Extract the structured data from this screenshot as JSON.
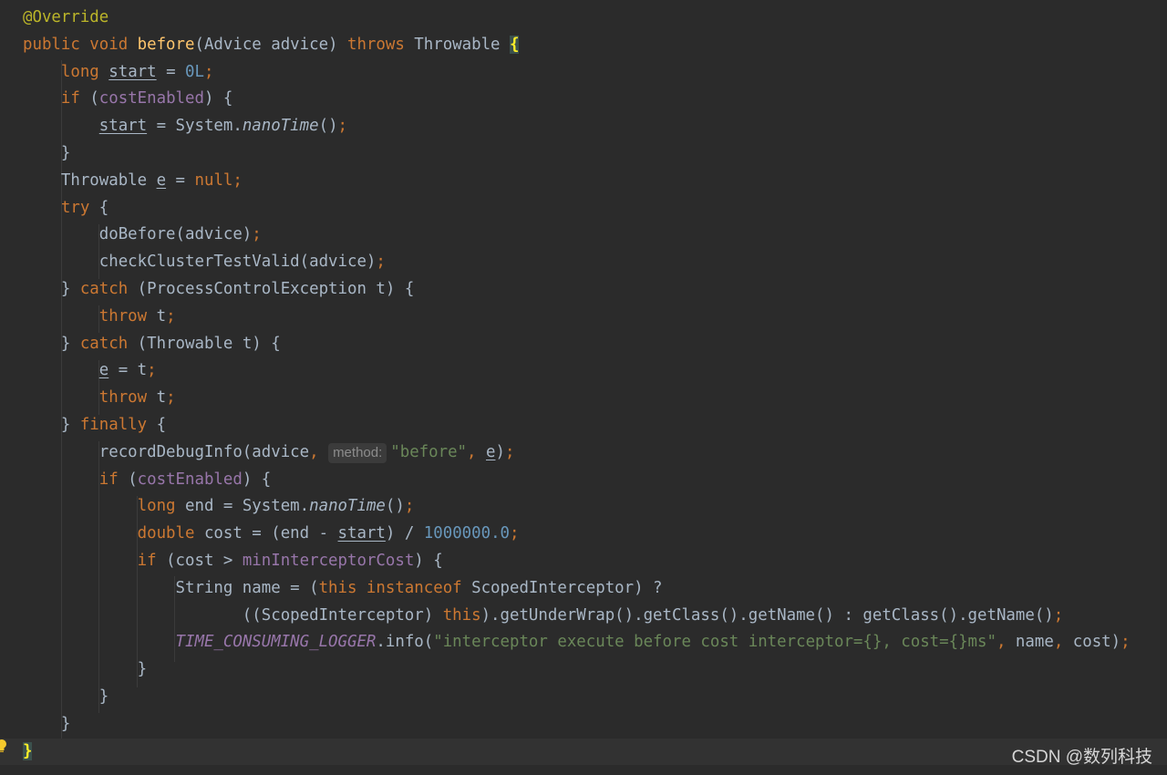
{
  "editor": {
    "lines": [
      {
        "segments": [
          {
            "t": "@Override",
            "c": "ann"
          }
        ]
      },
      {
        "segments": [
          {
            "t": "public void ",
            "c": "kw"
          },
          {
            "t": "before",
            "c": "fn"
          },
          {
            "t": "(Advice advice) "
          },
          {
            "t": "throws ",
            "c": "kw"
          },
          {
            "t": "Throwable "
          },
          {
            "t": "{",
            "c": "brace-hl"
          }
        ]
      },
      {
        "segments": [
          {
            "t": "    "
          },
          {
            "t": "long ",
            "c": "kw"
          },
          {
            "t": "start",
            "c": "ul"
          },
          {
            "t": " = "
          },
          {
            "t": "0L",
            "c": "num"
          },
          {
            "t": ";",
            "c": "kw"
          }
        ]
      },
      {
        "segments": [
          {
            "t": "    "
          },
          {
            "t": "if ",
            "c": "kw"
          },
          {
            "t": "("
          },
          {
            "t": "costEnabled",
            "c": "field"
          },
          {
            "t": ") {"
          }
        ]
      },
      {
        "segments": [
          {
            "t": "        "
          },
          {
            "t": "start",
            "c": "ul"
          },
          {
            "t": " = System."
          },
          {
            "t": "nanoTime",
            "c": "italic"
          },
          {
            "t": "()"
          },
          {
            "t": ";",
            "c": "kw"
          }
        ]
      },
      {
        "segments": [
          {
            "t": "    }"
          }
        ]
      },
      {
        "segments": [
          {
            "t": "    Throwable "
          },
          {
            "t": "e",
            "c": "ul"
          },
          {
            "t": " = "
          },
          {
            "t": "null",
            "c": "kw"
          },
          {
            "t": ";",
            "c": "kw"
          }
        ]
      },
      {
        "segments": [
          {
            "t": "    "
          },
          {
            "t": "try ",
            "c": "kw"
          },
          {
            "t": "{"
          }
        ]
      },
      {
        "segments": [
          {
            "t": "        doBefore(advice)"
          },
          {
            "t": ";",
            "c": "kw"
          }
        ]
      },
      {
        "segments": [
          {
            "t": "        checkClusterTestValid(advice)"
          },
          {
            "t": ";",
            "c": "kw"
          }
        ]
      },
      {
        "segments": [
          {
            "t": "    } "
          },
          {
            "t": "catch ",
            "c": "kw"
          },
          {
            "t": "(ProcessControlException t) {"
          }
        ]
      },
      {
        "segments": [
          {
            "t": "        "
          },
          {
            "t": "throw ",
            "c": "kw"
          },
          {
            "t": "t"
          },
          {
            "t": ";",
            "c": "kw"
          }
        ]
      },
      {
        "segments": [
          {
            "t": "    } "
          },
          {
            "t": "catch ",
            "c": "kw"
          },
          {
            "t": "(Throwable t) {"
          }
        ]
      },
      {
        "segments": [
          {
            "t": "        "
          },
          {
            "t": "e",
            "c": "ul"
          },
          {
            "t": " = t"
          },
          {
            "t": ";",
            "c": "kw"
          }
        ]
      },
      {
        "segments": [
          {
            "t": "        "
          },
          {
            "t": "throw ",
            "c": "kw"
          },
          {
            "t": "t"
          },
          {
            "t": ";",
            "c": "kw"
          }
        ]
      },
      {
        "segments": [
          {
            "t": "    } "
          },
          {
            "t": "finally ",
            "c": "kw"
          },
          {
            "t": "{"
          }
        ]
      },
      {
        "segments": [
          {
            "t": "        recordDebugInfo(advice"
          },
          {
            "t": ", ",
            "c": "kw"
          },
          {
            "t": "method:",
            "c": "hint"
          },
          {
            "t": "\"before\"",
            "c": "str"
          },
          {
            "t": ", ",
            "c": "kw"
          },
          {
            "t": "e",
            "c": "ul"
          },
          {
            "t": ")"
          },
          {
            "t": ";",
            "c": "kw"
          }
        ]
      },
      {
        "segments": [
          {
            "t": "        "
          },
          {
            "t": "if ",
            "c": "kw"
          },
          {
            "t": "("
          },
          {
            "t": "costEnabled",
            "c": "field"
          },
          {
            "t": ") {"
          }
        ]
      },
      {
        "segments": [
          {
            "t": "            "
          },
          {
            "t": "long ",
            "c": "kw"
          },
          {
            "t": "end = System."
          },
          {
            "t": "nanoTime",
            "c": "italic"
          },
          {
            "t": "()"
          },
          {
            "t": ";",
            "c": "kw"
          }
        ]
      },
      {
        "segments": [
          {
            "t": "            "
          },
          {
            "t": "double ",
            "c": "kw"
          },
          {
            "t": "cost = (end - "
          },
          {
            "t": "start",
            "c": "ul"
          },
          {
            "t": ") / "
          },
          {
            "t": "1000000.0",
            "c": "num"
          },
          {
            "t": ";",
            "c": "kw"
          }
        ]
      },
      {
        "segments": [
          {
            "t": "            "
          },
          {
            "t": "if ",
            "c": "kw"
          },
          {
            "t": "(cost > "
          },
          {
            "t": "minInterceptorCost",
            "c": "field"
          },
          {
            "t": ") {"
          }
        ]
      },
      {
        "segments": [
          {
            "t": "                String name = ("
          },
          {
            "t": "this instanceof ",
            "c": "kw"
          },
          {
            "t": "ScopedInterceptor) ?"
          }
        ]
      },
      {
        "segments": [
          {
            "t": "                       ((ScopedInterceptor) "
          },
          {
            "t": "this",
            "c": "kw"
          },
          {
            "t": ").getUnderWrap().getClass().getName() : getClass().getName()"
          },
          {
            "t": ";",
            "c": "kw"
          }
        ]
      },
      {
        "segments": [
          {
            "t": "                "
          },
          {
            "t": "TIME_CONSUMING_LOGGER",
            "c": "static"
          },
          {
            "t": ".info("
          },
          {
            "t": "\"interceptor execute before cost interceptor={}, cost={}ms\"",
            "c": "str"
          },
          {
            "t": ", ",
            "c": "kw"
          },
          {
            "t": "name"
          },
          {
            "t": ", ",
            "c": "kw"
          },
          {
            "t": "cost)"
          },
          {
            "t": ";",
            "c": "kw"
          }
        ]
      },
      {
        "segments": [
          {
            "t": "            }"
          }
        ]
      },
      {
        "segments": [
          {
            "t": "        }"
          }
        ]
      },
      {
        "segments": [
          {
            "t": "    }"
          }
        ]
      },
      {
        "segments": [
          {
            "t": "}",
            "c": "brace-hl"
          }
        ],
        "current": true
      }
    ]
  },
  "watermark": "CSDN @数列科技",
  "icons": {
    "gutter": "lightbulb-icon"
  },
  "colors": {
    "background": "#2b2b2b",
    "keyword": "#cc7832",
    "annotation": "#bbb529",
    "method": "#ffc66d",
    "number": "#6897bb",
    "string": "#6a8759",
    "field": "#9876aa",
    "text": "#a9b7c6"
  }
}
